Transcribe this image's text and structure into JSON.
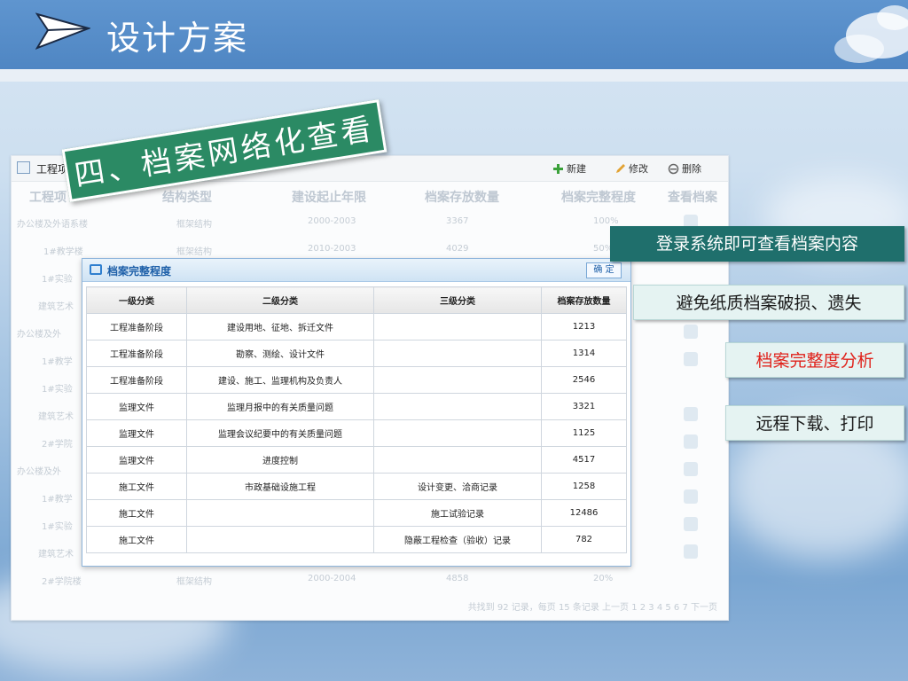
{
  "header": {
    "title": "设计方案"
  },
  "stamp": {
    "text": "四、档案网络化查看"
  },
  "app": {
    "title": "工程项",
    "toolbar": {
      "new": "新建",
      "edit": "修改",
      "delete": "删除"
    },
    "columns": [
      "工程项",
      "结构类型",
      "建设起止年限",
      "档案存放数量",
      "档案完整程度",
      "查看档案"
    ],
    "rows": [
      [
        "办公楼及外语系楼",
        "框架结构",
        "2000-2003",
        "3367",
        "100%"
      ],
      [
        "1#教学楼",
        "框架结构",
        "2010-2003",
        "4029",
        "50%"
      ],
      [
        "1#实验",
        "",
        "",
        "",
        ""
      ],
      [
        "建筑艺术",
        "",
        "",
        "",
        ""
      ],
      [
        "办公楼及外",
        "",
        "",
        "",
        ""
      ],
      [
        "1#教学",
        "",
        "",
        "",
        ""
      ],
      [
        "1#实验",
        "",
        "",
        "",
        ""
      ],
      [
        "建筑艺术",
        "",
        "",
        "",
        ""
      ],
      [
        "2#学院",
        "",
        "",
        "",
        ""
      ],
      [
        "办公楼及外",
        "",
        "",
        "",
        ""
      ],
      [
        "1#教学",
        "",
        "",
        "",
        ""
      ],
      [
        "1#实验",
        "",
        "",
        "",
        ""
      ],
      [
        "建筑艺术",
        "",
        "",
        "",
        ""
      ],
      [
        "2#学院楼",
        "框架结构",
        "2000-2004",
        "4858",
        "20%"
      ]
    ],
    "pager": "共找到 92 记录，每页 15 条记录  上一页  1  2  3  4  5  6  7  下一页"
  },
  "dialog": {
    "title": "档案完整程度",
    "ok_label": "确 定",
    "columns": [
      "一级分类",
      "二级分类",
      "三级分类",
      "档案存放数量"
    ],
    "rows": [
      [
        "工程准备阶段",
        "建设用地、征地、拆迁文件",
        "",
        "1213"
      ],
      [
        "工程准备阶段",
        "勘察、测绘、设计文件",
        "",
        "1314"
      ],
      [
        "工程准备阶段",
        "建设、施工、监理机构及负责人",
        "",
        "2546"
      ],
      [
        "监理文件",
        "监理月报中的有关质量问题",
        "",
        "3321"
      ],
      [
        "监理文件",
        "监理会议纪要中的有关质量问题",
        "",
        "1125"
      ],
      [
        "监理文件",
        "进度控制",
        "",
        "4517"
      ],
      [
        "施工文件",
        "市政基础设施工程",
        "设计变更、洽商记录",
        "1258"
      ],
      [
        "施工文件",
        "",
        "施工试验记录",
        "12486"
      ],
      [
        "施工文件",
        "",
        "隐蔽工程检查（验收）记录",
        "782"
      ]
    ]
  },
  "callouts": {
    "login": "登录系统即可查看档案内容",
    "avoid": "避免纸质档案破损、遗失",
    "analysis": "档案完整度分析",
    "download": "远程下载、打印"
  }
}
